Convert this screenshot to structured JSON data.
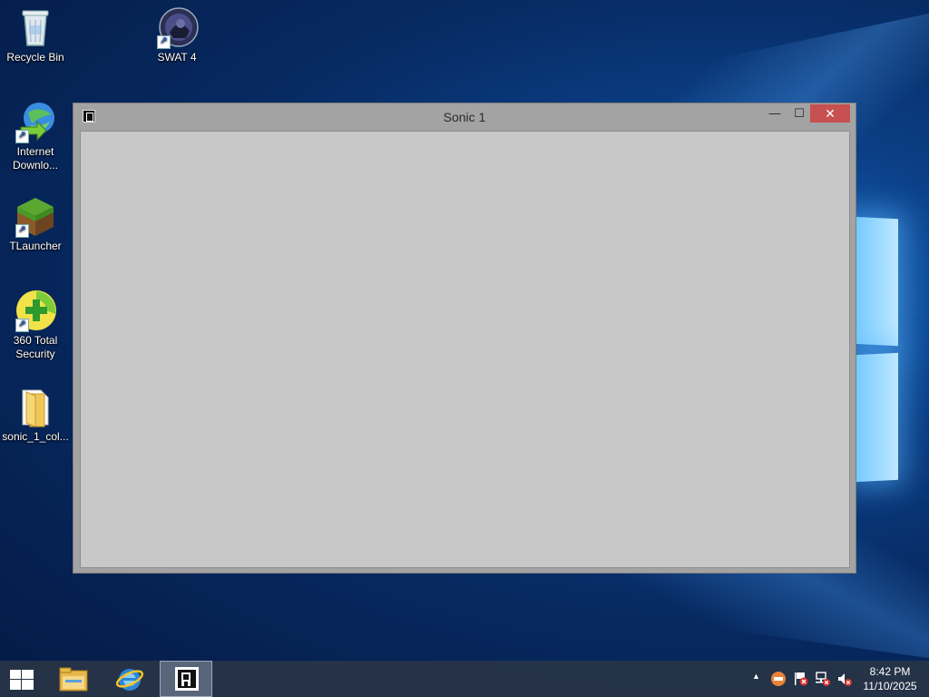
{
  "desktop": {
    "icons": [
      {
        "label": "Recycle Bin"
      },
      {
        "label": "SWAT 4"
      },
      {
        "label": "Internet Downlo..."
      },
      {
        "label": "TLauncher"
      },
      {
        "label": "360 Total Security"
      },
      {
        "label": "sonic_1_col..."
      }
    ]
  },
  "window": {
    "title": "Sonic 1",
    "minimize_glyph": "—",
    "maximize_glyph": "☐",
    "close_glyph": "✕"
  },
  "taskbar": {
    "pinned": [
      "file-explorer",
      "internet-explorer",
      "sonic-app"
    ],
    "active": "sonic-app",
    "tray": {
      "overflow_glyph": "▲",
      "icons": [
        "360-security-icon",
        "action-center-flag-icon",
        "network-icon",
        "volume-muted-icon"
      ]
    },
    "clock": {
      "time": "8:42 PM",
      "date": "11/10/2025"
    }
  },
  "colors": {
    "close_button": "#c75050",
    "window_frame": "#a3a3a3",
    "client_area": "#c8c8c8",
    "taskbar": "#283446"
  }
}
